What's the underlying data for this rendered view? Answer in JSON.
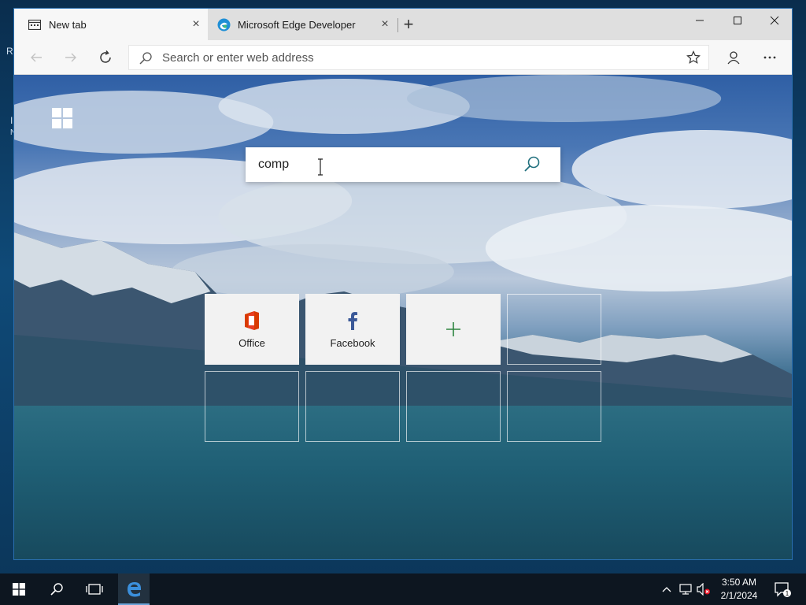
{
  "desktop": {
    "edge_chars": [
      "R",
      "I",
      "N"
    ]
  },
  "browser": {
    "tabs": [
      {
        "title": "New tab",
        "icon": "newtab-page-icon",
        "active": true
      },
      {
        "title": "Microsoft Edge Developer",
        "icon": "edge-logo-icon",
        "active": false
      }
    ],
    "address": {
      "placeholder": "Search or enter web address",
      "value": ""
    },
    "new_tab_page": {
      "search_value": "comp",
      "tiles": [
        {
          "label": "Office",
          "icon": "office-icon"
        },
        {
          "label": "Facebook",
          "icon": "facebook-icon"
        },
        {
          "label": "",
          "icon": "plus-icon"
        }
      ]
    }
  },
  "taskbar": {
    "time": "3:50 AM",
    "date": "2/1/2024",
    "notification_count": "1"
  },
  "colors": {
    "office_red": "#d83b01",
    "facebook_blue": "#3b5998",
    "add_green": "#2e8540",
    "window_border": "#2a6fb0"
  }
}
